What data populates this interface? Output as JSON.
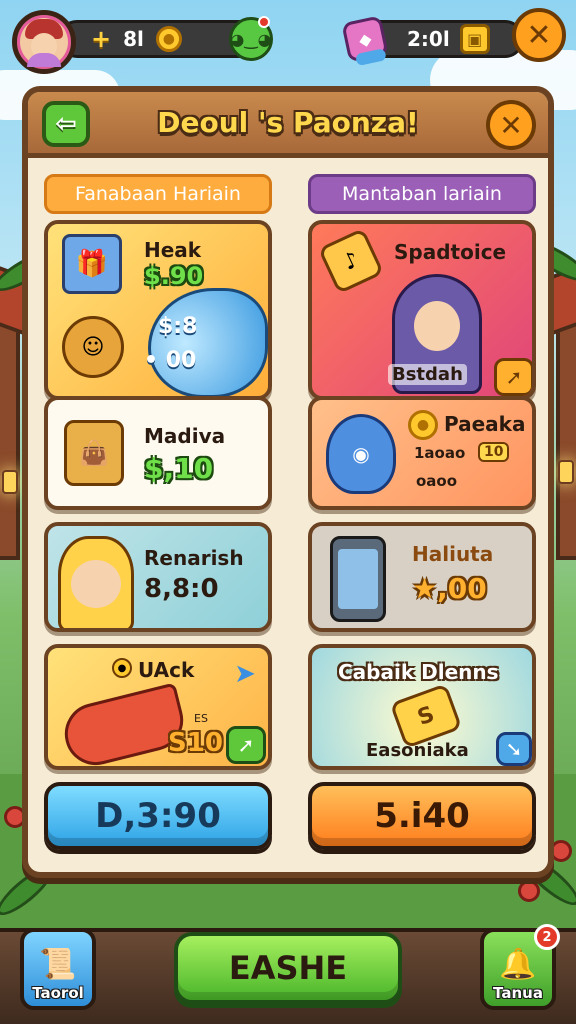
{
  "hud": {
    "left_plus": "+",
    "left_count": "8l",
    "right_timer": "2:0l"
  },
  "panel": {
    "title": "Deoul 's Paonza!",
    "back_label": "⇦",
    "close_label": "✕"
  },
  "columns": {
    "left_tab": "Fanabaan Hariain",
    "right_tab": "Mantaban lariain"
  },
  "cards": {
    "heak": {
      "title": "Heak",
      "price": "$.90",
      "sub1": "$:8",
      "sub2": "• 00"
    },
    "spadtoice": {
      "title": "Spadtoice",
      "label": "Bstdah"
    },
    "madiva": {
      "title": "Madiva",
      "price": "$,10"
    },
    "paeaka": {
      "title": "Paeaka",
      "sub": "1aoao",
      "tag": "10",
      "sub2": "oaoo"
    },
    "renarish": {
      "title": "Renarish",
      "price": "8,8:0"
    },
    "haliuta": {
      "title": "Haliuta",
      "price": "★,00"
    },
    "uack": {
      "title": "UAck",
      "small": "ES",
      "price": "S10"
    },
    "cabaik": {
      "title": "Cabaik Dlenns",
      "label": "Easoniaka"
    }
  },
  "buttons": {
    "blue_price": "D,3:90",
    "orange_price": "5.i40"
  },
  "bottom": {
    "left_label": "Taorol",
    "main_action": "EASHE",
    "right_label": "Tanua",
    "right_badge": "2"
  },
  "colors": {
    "panel_border": "#6b4322",
    "tab_left": "#ffac3e",
    "tab_right": "#9b5fb8",
    "accent_green": "#5fc83a",
    "accent_orange": "#ffa01f"
  }
}
